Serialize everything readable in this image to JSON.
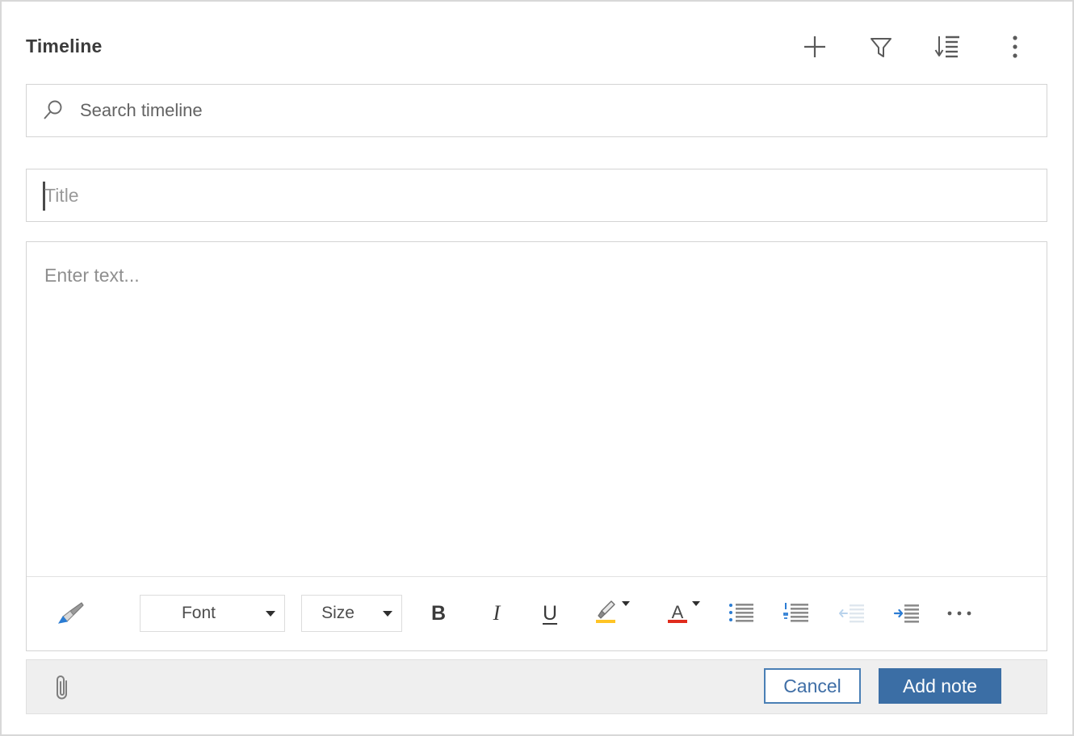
{
  "header": {
    "title": "Timeline",
    "actions": [
      {
        "name": "add-icon",
        "label": "Add"
      },
      {
        "name": "filter-icon",
        "label": "Filter"
      },
      {
        "name": "sort-icon",
        "label": "Sort"
      },
      {
        "name": "more-options-icon",
        "label": "More options"
      }
    ]
  },
  "search": {
    "placeholder": "Search timeline",
    "value": "",
    "icon": "search-icon"
  },
  "title_field": {
    "placeholder": "Title",
    "value": "",
    "focused": true
  },
  "body_field": {
    "placeholder": "Enter text...",
    "value": ""
  },
  "format_toolbar": {
    "format_painter": {
      "label": "Format painter",
      "icon": "paintbrush-icon"
    },
    "font": {
      "label": "Font",
      "icon": "chevron-down-icon"
    },
    "size": {
      "label": "Size",
      "icon": "chevron-down-icon"
    },
    "bold": {
      "label": "B"
    },
    "italic": {
      "label": "I"
    },
    "underline": {
      "label": "U"
    },
    "highlight": {
      "label": "Text highlight color",
      "bar_color": "#ffc425"
    },
    "font_color": {
      "label": "A",
      "bar_color": "#e02b1d"
    },
    "bulleted_list": {
      "label": "Bulleted list"
    },
    "numbered_list": {
      "label": "Numbered list"
    },
    "decrease_indent": {
      "label": "Decrease indent",
      "enabled": false
    },
    "increase_indent": {
      "label": "Increase indent",
      "enabled": true
    },
    "more_formatting": {
      "label": "More formatting options"
    }
  },
  "footer": {
    "attach": {
      "label": "Attach file",
      "icon": "paperclip-icon"
    },
    "cancel_label": "Cancel",
    "submit_label": "Add note"
  },
  "colors": {
    "accent_blue": "#3b6ea5",
    "cancel_border": "#4a7fb5",
    "panel_border": "#d4d4d4",
    "footer_bg": "#efefef",
    "title_text": "#3b3b3b",
    "placeholder_text": "#8f8f8f",
    "icon_grey": "#4a4a4a",
    "icon_blue": "#2b7cd3",
    "icon_disabled": "#c9d8e8"
  }
}
